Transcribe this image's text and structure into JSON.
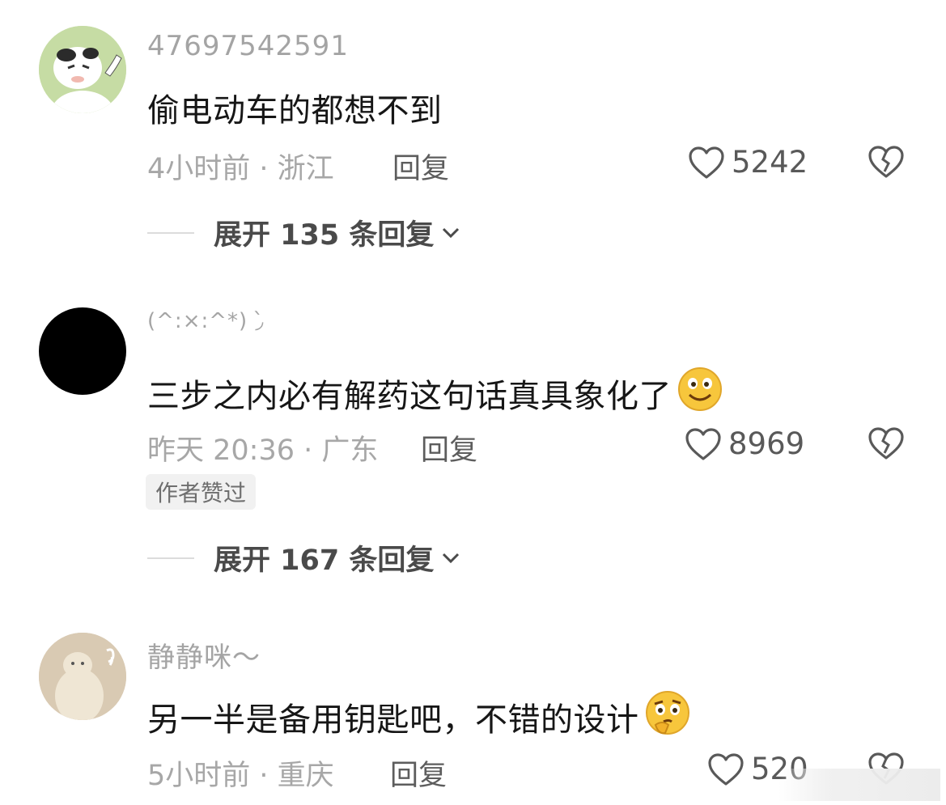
{
  "comments": [
    {
      "username": "47697542591",
      "text": "偷电动车的都想不到",
      "time_location": "4小时前 · 浙江",
      "reply_label": "回复",
      "likes": "5242",
      "avatar": "cartoon-cow-avatar",
      "expand_label": "展开 135 条回复"
    },
    {
      "username": "(^:×:^*) ◞̀",
      "text": "三步之内必有解药这句话真具象化了",
      "emoji": "smile-emoji",
      "time_location": "昨天 20:36 · 广东",
      "reply_label": "回复",
      "likes": "8969",
      "badge": "作者赞过",
      "avatar": "black-avatar",
      "expand_label": "展开 167 条回复"
    },
    {
      "username": "静静咪～",
      "text": "另一半是备用钥匙吧，不错的设计",
      "emoji": "thinking-emoji",
      "time_location": "5小时前 · 重庆",
      "reply_label": "回复",
      "likes": "520",
      "avatar": "capybara-avatar"
    }
  ],
  "icons": {
    "like": "heart-outline-icon",
    "dislike": "broken-heart-icon",
    "expand": "chevron-down-icon"
  },
  "colors": {
    "username": "#a4a4a4",
    "text": "#161616",
    "meta": "#a7a7a7",
    "icon": "#595959"
  }
}
